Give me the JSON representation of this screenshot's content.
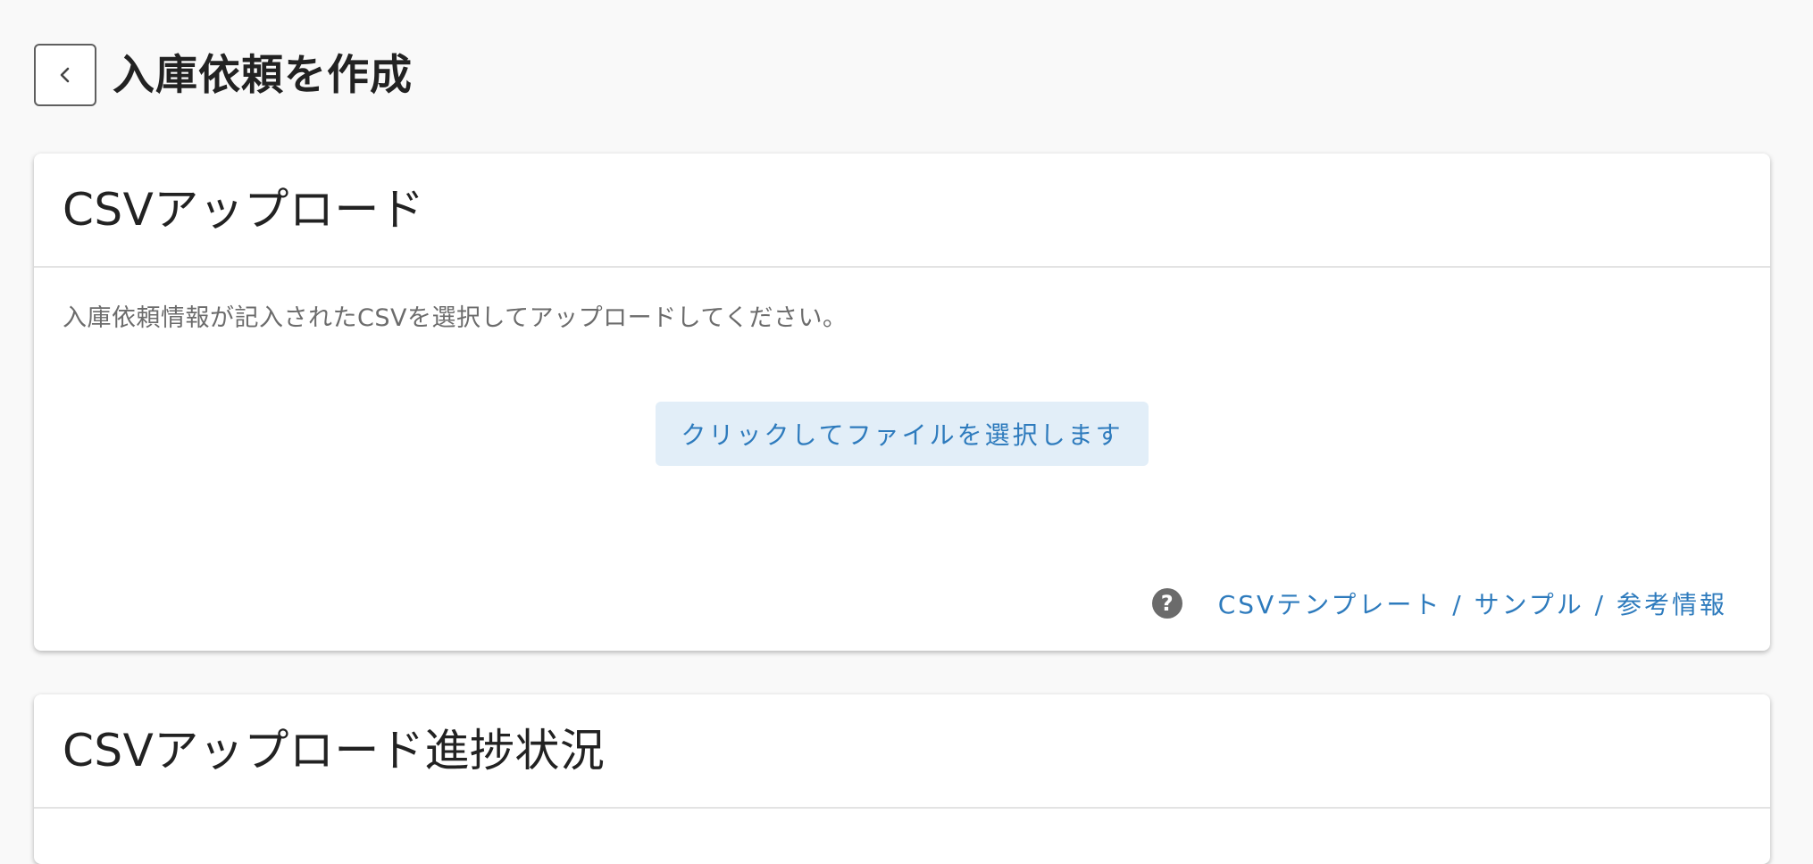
{
  "header": {
    "title": "入庫依頼を作成",
    "back_icon": "chevron-left-icon"
  },
  "upload_card": {
    "title": "CSVアップロード",
    "description": "入庫依頼情報が記入されたCSVを選択してアップロードしてください。",
    "select_button_label": "クリックしてファイルを選択します",
    "help_icon": "question-circle-icon",
    "help_link_label": "CSVテンプレート / サンプル / 参考情報"
  },
  "progress_card": {
    "title": "CSVアップロード進捗状況"
  },
  "colors": {
    "background": "#f9f9f9",
    "accent": "#2e7bbd",
    "button_bg": "#e2eef8"
  }
}
